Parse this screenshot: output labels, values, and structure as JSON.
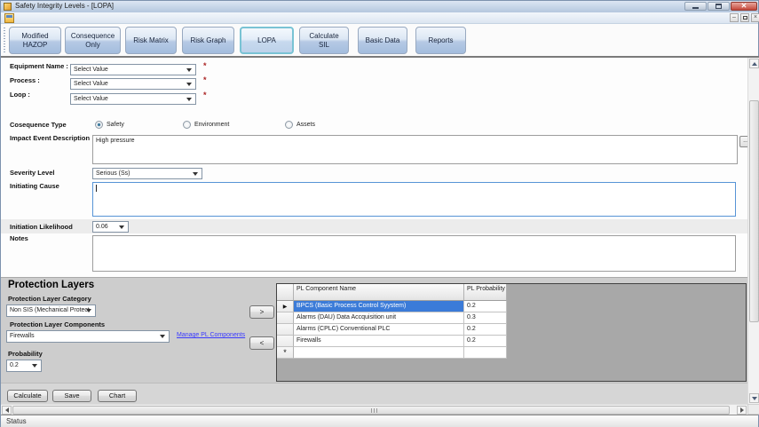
{
  "window": {
    "title": "Safety Integrity Levels - [LOPA]"
  },
  "toolbar": {
    "buttons": [
      {
        "label": "Modified HAZOP",
        "active": false
      },
      {
        "label": "Consequence Only",
        "active": false
      },
      {
        "label": "Risk Matrix",
        "active": false
      },
      {
        "label": "Risk Graph",
        "active": false
      },
      {
        "label": "LOPA",
        "active": true
      },
      {
        "label": "Calculate SIL",
        "active": false
      },
      {
        "label": "Basic Data",
        "active": false
      },
      {
        "label": "Reports",
        "active": false
      }
    ]
  },
  "form": {
    "required_marker": "*",
    "equipment_name": {
      "label": "Equipment Name :",
      "value": "Select Value"
    },
    "process": {
      "label": "Process :",
      "value": "Select Value"
    },
    "loop": {
      "label": "Loop :",
      "value": "Select Value"
    },
    "consequence_type": {
      "label": "Cosequence Type",
      "options": [
        {
          "label": "Safety",
          "selected": true
        },
        {
          "label": "Environment",
          "selected": false
        },
        {
          "label": "Assets",
          "selected": false
        }
      ]
    },
    "impact_event_description": {
      "label": "Impact Event Description",
      "value": "High pressure",
      "browse_label": "..."
    },
    "severity_level": {
      "label": "Severity Level",
      "value": "Serious (Ss)"
    },
    "initiating_cause": {
      "label": "Initiating Cause",
      "value": ""
    },
    "initiation_likelihood": {
      "label": "Initiation Likelihood",
      "value": "0.06"
    },
    "notes": {
      "label": "Notes",
      "value": ""
    }
  },
  "protection_layers": {
    "heading": "Protection Layers",
    "category_label": "Protection Layer Category",
    "category_value": "Non SIS (Mechanical Protect",
    "components_label": "Protection Layer Components",
    "components_value": "Firewalls",
    "manage_link": "Manage PL Components",
    "probability_label": "Probability",
    "probability_value": "0.2",
    "add_button": ">",
    "remove_button": "<",
    "grid": {
      "columns": [
        "PL Component Name",
        "PL Probability"
      ],
      "selected_row_marker": "▶",
      "new_row_marker": "*",
      "rows": [
        {
          "name": "BPCS (Basic Process Control Syystem)",
          "probability": "0.2"
        },
        {
          "name": "Alarms (DAU) Data Accquisition unit",
          "probability": "0.3"
        },
        {
          "name": "Alarms (CPLC) Conventional PLC",
          "probability": "0.2"
        },
        {
          "name": "Firewalls",
          "probability": "0.2"
        }
      ]
    }
  },
  "actions": [
    {
      "label": "Calculate"
    },
    {
      "label": "Save"
    },
    {
      "label": "Chart"
    }
  ],
  "status_bar": {
    "text": "Status"
  }
}
